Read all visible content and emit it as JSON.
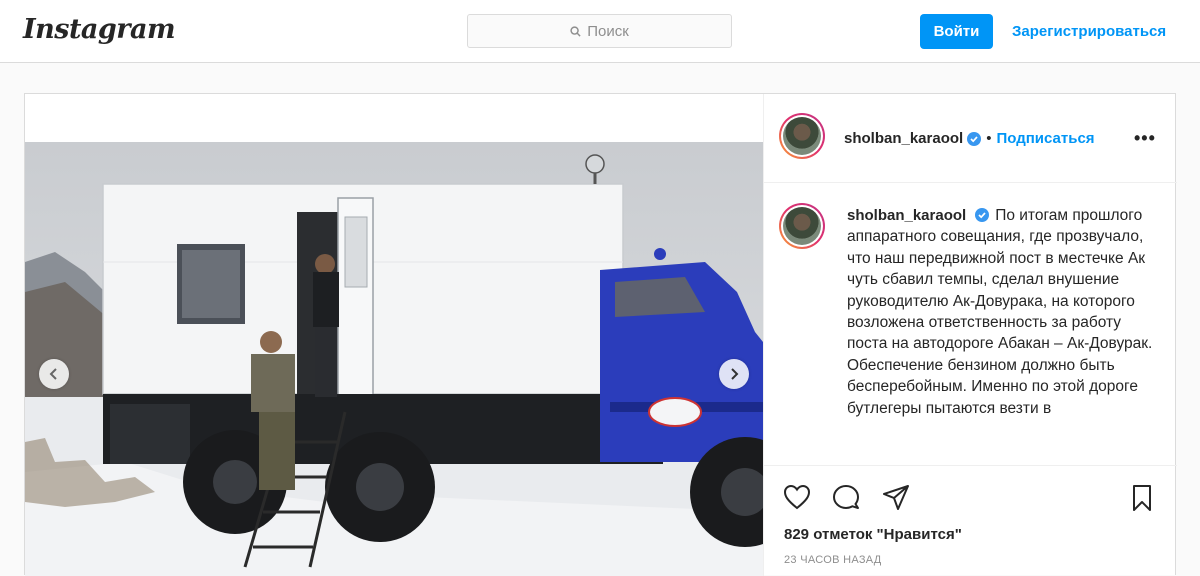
{
  "header": {
    "logo": "Instagram",
    "search_placeholder": "Поиск",
    "login_label": "Войти",
    "register_label": "Зарегистрироваться"
  },
  "post": {
    "username": "sholban_karaool",
    "follow_label": "Подписаться",
    "separator": "•",
    "caption": "По итогам прошлого аппаратного совещания, где прозвучало, что наш передвижной пост в местечке Ак чуть сбавил темпы, сделал внушение руководителю Ак-Довурака, на которого возложена ответственность за работу поста  на автодороге Абакан – Ак-Довурак. Обеспечение бензином должно быть бесперебойным. Именно по этой дороге  бутлегеры пытаются  везти в",
    "likes": "829 отметок \"Нравится\"",
    "time": "23 ЧАСОВ НАЗАД"
  },
  "colors": {
    "accent": "#0095f6",
    "border": "#dbdbdb",
    "truck_cab": "#2b3dbb"
  },
  "icons": [
    "search-icon",
    "verified-icon",
    "more-icon",
    "heart-icon",
    "comment-icon",
    "share-icon",
    "bookmark-icon",
    "chevron-left-icon",
    "chevron-right-icon"
  ]
}
